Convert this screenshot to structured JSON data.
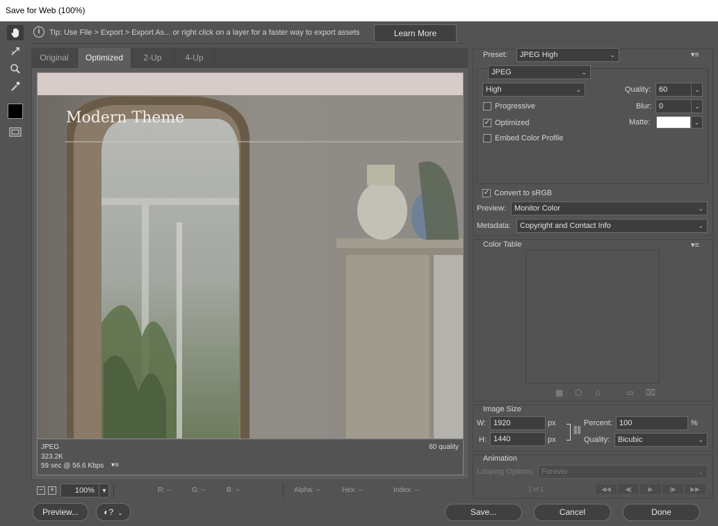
{
  "window": {
    "title": "Save for Web (100%)"
  },
  "tools": {
    "hand": "hand-icon",
    "slice_select": "slice-select-icon",
    "zoom": "zoom-icon",
    "eyedropper": "eyedropper-icon",
    "eyedropper_color": "#000000",
    "toggle_slices": "toggle-slices-icon"
  },
  "tip": {
    "text": "Tip: Use File > Export > Export As...  or right click on a layer for a faster way to export assets",
    "learn_more": "Learn More"
  },
  "tabs": [
    "Original",
    "Optimized",
    "2-Up",
    "4-Up"
  ],
  "selected_tab": "Optimized",
  "preview": {
    "heading": "Modern Theme",
    "header_bg": "#d8ccca"
  },
  "info": {
    "format": "JPEG",
    "size": "323.2K",
    "time": "59 sec @ 56.6 Kbps",
    "quality": "60 quality"
  },
  "bottom": {
    "zoom": "100%",
    "r": "R: --",
    "g": "G: --",
    "b": "B: --",
    "alpha": "Alpha: --",
    "hex": "Hex: --",
    "index": "Index: --"
  },
  "settings": {
    "preset_label": "Preset:",
    "preset_value": "JPEG High",
    "format": "JPEG",
    "compression": "High",
    "quality_label": "Quality:",
    "quality_value": "60",
    "blur_label": "Blur:",
    "blur_value": "0",
    "matte_label": "Matte:",
    "matte_color": "#ffffff",
    "progressive": "Progressive",
    "progressive_checked": false,
    "optimized": "Optimized",
    "optimized_checked": true,
    "embed_profile": "Embed Color Profile",
    "embed_checked": false,
    "convert_srgb": "Convert to sRGB",
    "convert_checked": true,
    "preview_label": "Preview:",
    "preview_value": "Monitor Color",
    "metadata_label": "Metadata:",
    "metadata_value": "Copyright and Contact Info"
  },
  "color_table": {
    "title": "Color Table"
  },
  "image_size": {
    "title": "Image Size",
    "w_label": "W:",
    "w_value": "1920",
    "h_label": "H:",
    "h_value": "1440",
    "unit": "px",
    "percent_label": "Percent:",
    "percent_value": "100",
    "percent_unit": "%",
    "quality_label": "Quality:",
    "quality_value": "Bicubic"
  },
  "animation": {
    "title": "Animation",
    "looping_label": "Looping Options:",
    "looping_value": "Forever",
    "frame": "1 of 1"
  },
  "footer": {
    "preview": "Preview...",
    "save": "Save...",
    "cancel": "Cancel",
    "done": "Done"
  }
}
